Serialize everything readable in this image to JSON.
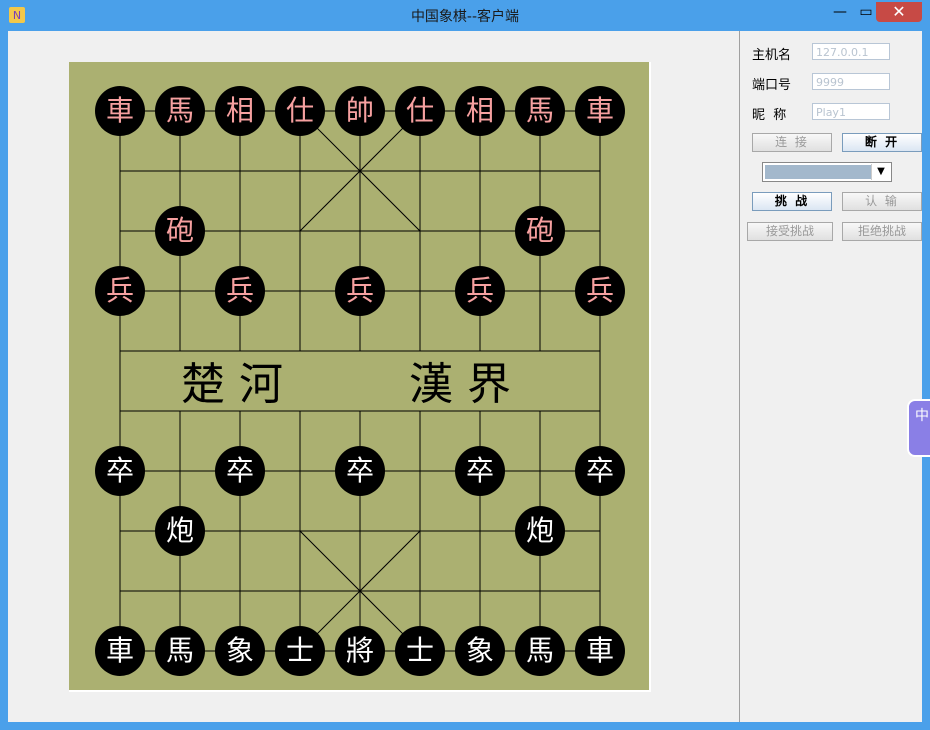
{
  "window": {
    "title": "中国象棋--客户端",
    "app_icon": "app-logo-icon"
  },
  "controls": {
    "minimize": "—",
    "maximize": "▭",
    "close": "✕"
  },
  "board": {
    "river_left": "楚 河",
    "river_right": "漢 界",
    "pieces_top_back": [
      "車",
      "馬",
      "相",
      "仕",
      "帥",
      "仕",
      "相",
      "馬",
      "車"
    ],
    "pieces_top_cannons": [
      "砲",
      "砲"
    ],
    "pieces_top_soldiers": [
      "兵",
      "兵",
      "兵",
      "兵",
      "兵"
    ],
    "pieces_bottom_soldiers": [
      "卒",
      "卒",
      "卒",
      "卒",
      "卒"
    ],
    "pieces_bottom_cannons": [
      "炮",
      "炮"
    ],
    "pieces_bottom_back": [
      "車",
      "馬",
      "象",
      "士",
      "將",
      "士",
      "象",
      "馬",
      "車"
    ],
    "colors": {
      "board": "#abb071",
      "piece": "#000000",
      "red_text": "#f6a0a0",
      "black_text": "#ffffff"
    }
  },
  "panel": {
    "host_label": "主机名",
    "host_value": "127.0.0.1",
    "port_label": "端口号",
    "port_value": "9999",
    "nick_label": "昵  称",
    "nick_value": "Play1",
    "connect_btn": "连 接",
    "disconnect_btn": "断 开",
    "challenge_btn": "挑 战",
    "resign_btn": "认 输",
    "accept_btn": "接受挑战",
    "reject_btn": "拒绝挑战"
  },
  "side_tab": {
    "label": "中"
  }
}
